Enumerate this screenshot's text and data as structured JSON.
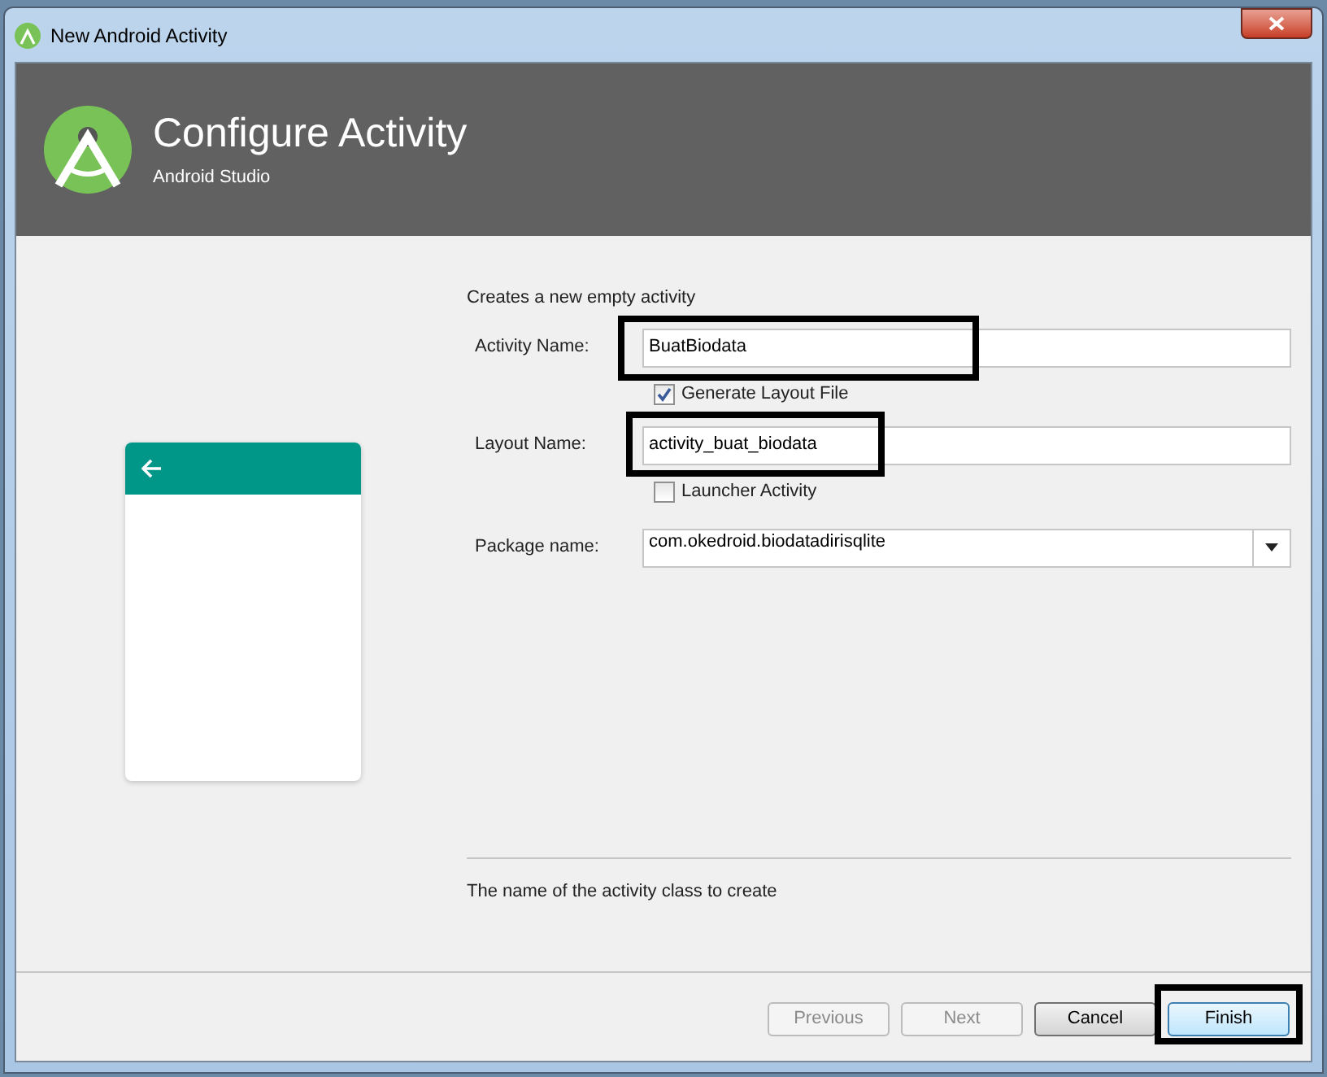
{
  "window": {
    "title": "New Android Activity"
  },
  "header": {
    "title": "Configure Activity",
    "subtitle": "Android Studio"
  },
  "intro": "Creates a new empty activity",
  "fields": [
    {
      "kind": "text",
      "label": "Activity Name:",
      "value": "BuatBiodata",
      "highlighted": true
    },
    {
      "kind": "checkbox",
      "label": "Generate Layout File",
      "checked": true
    },
    {
      "kind": "text",
      "label": "Layout Name:",
      "value": "activity_buat_biodata",
      "highlighted": true
    },
    {
      "kind": "checkbox",
      "label": "Launcher Activity",
      "checked": false
    },
    {
      "kind": "combo",
      "label": "Package name:",
      "value": "com.okedroid.biodatadirisqlite"
    }
  ],
  "description": "The name of the activity class to create",
  "buttons": [
    {
      "label": "Previous",
      "disabled": true,
      "highlighted": false
    },
    {
      "label": "Next",
      "disabled": true,
      "highlighted": false
    },
    {
      "label": "Cancel",
      "disabled": false,
      "highlighted": false
    },
    {
      "label": "Finish",
      "disabled": false,
      "highlighted": true
    }
  ]
}
